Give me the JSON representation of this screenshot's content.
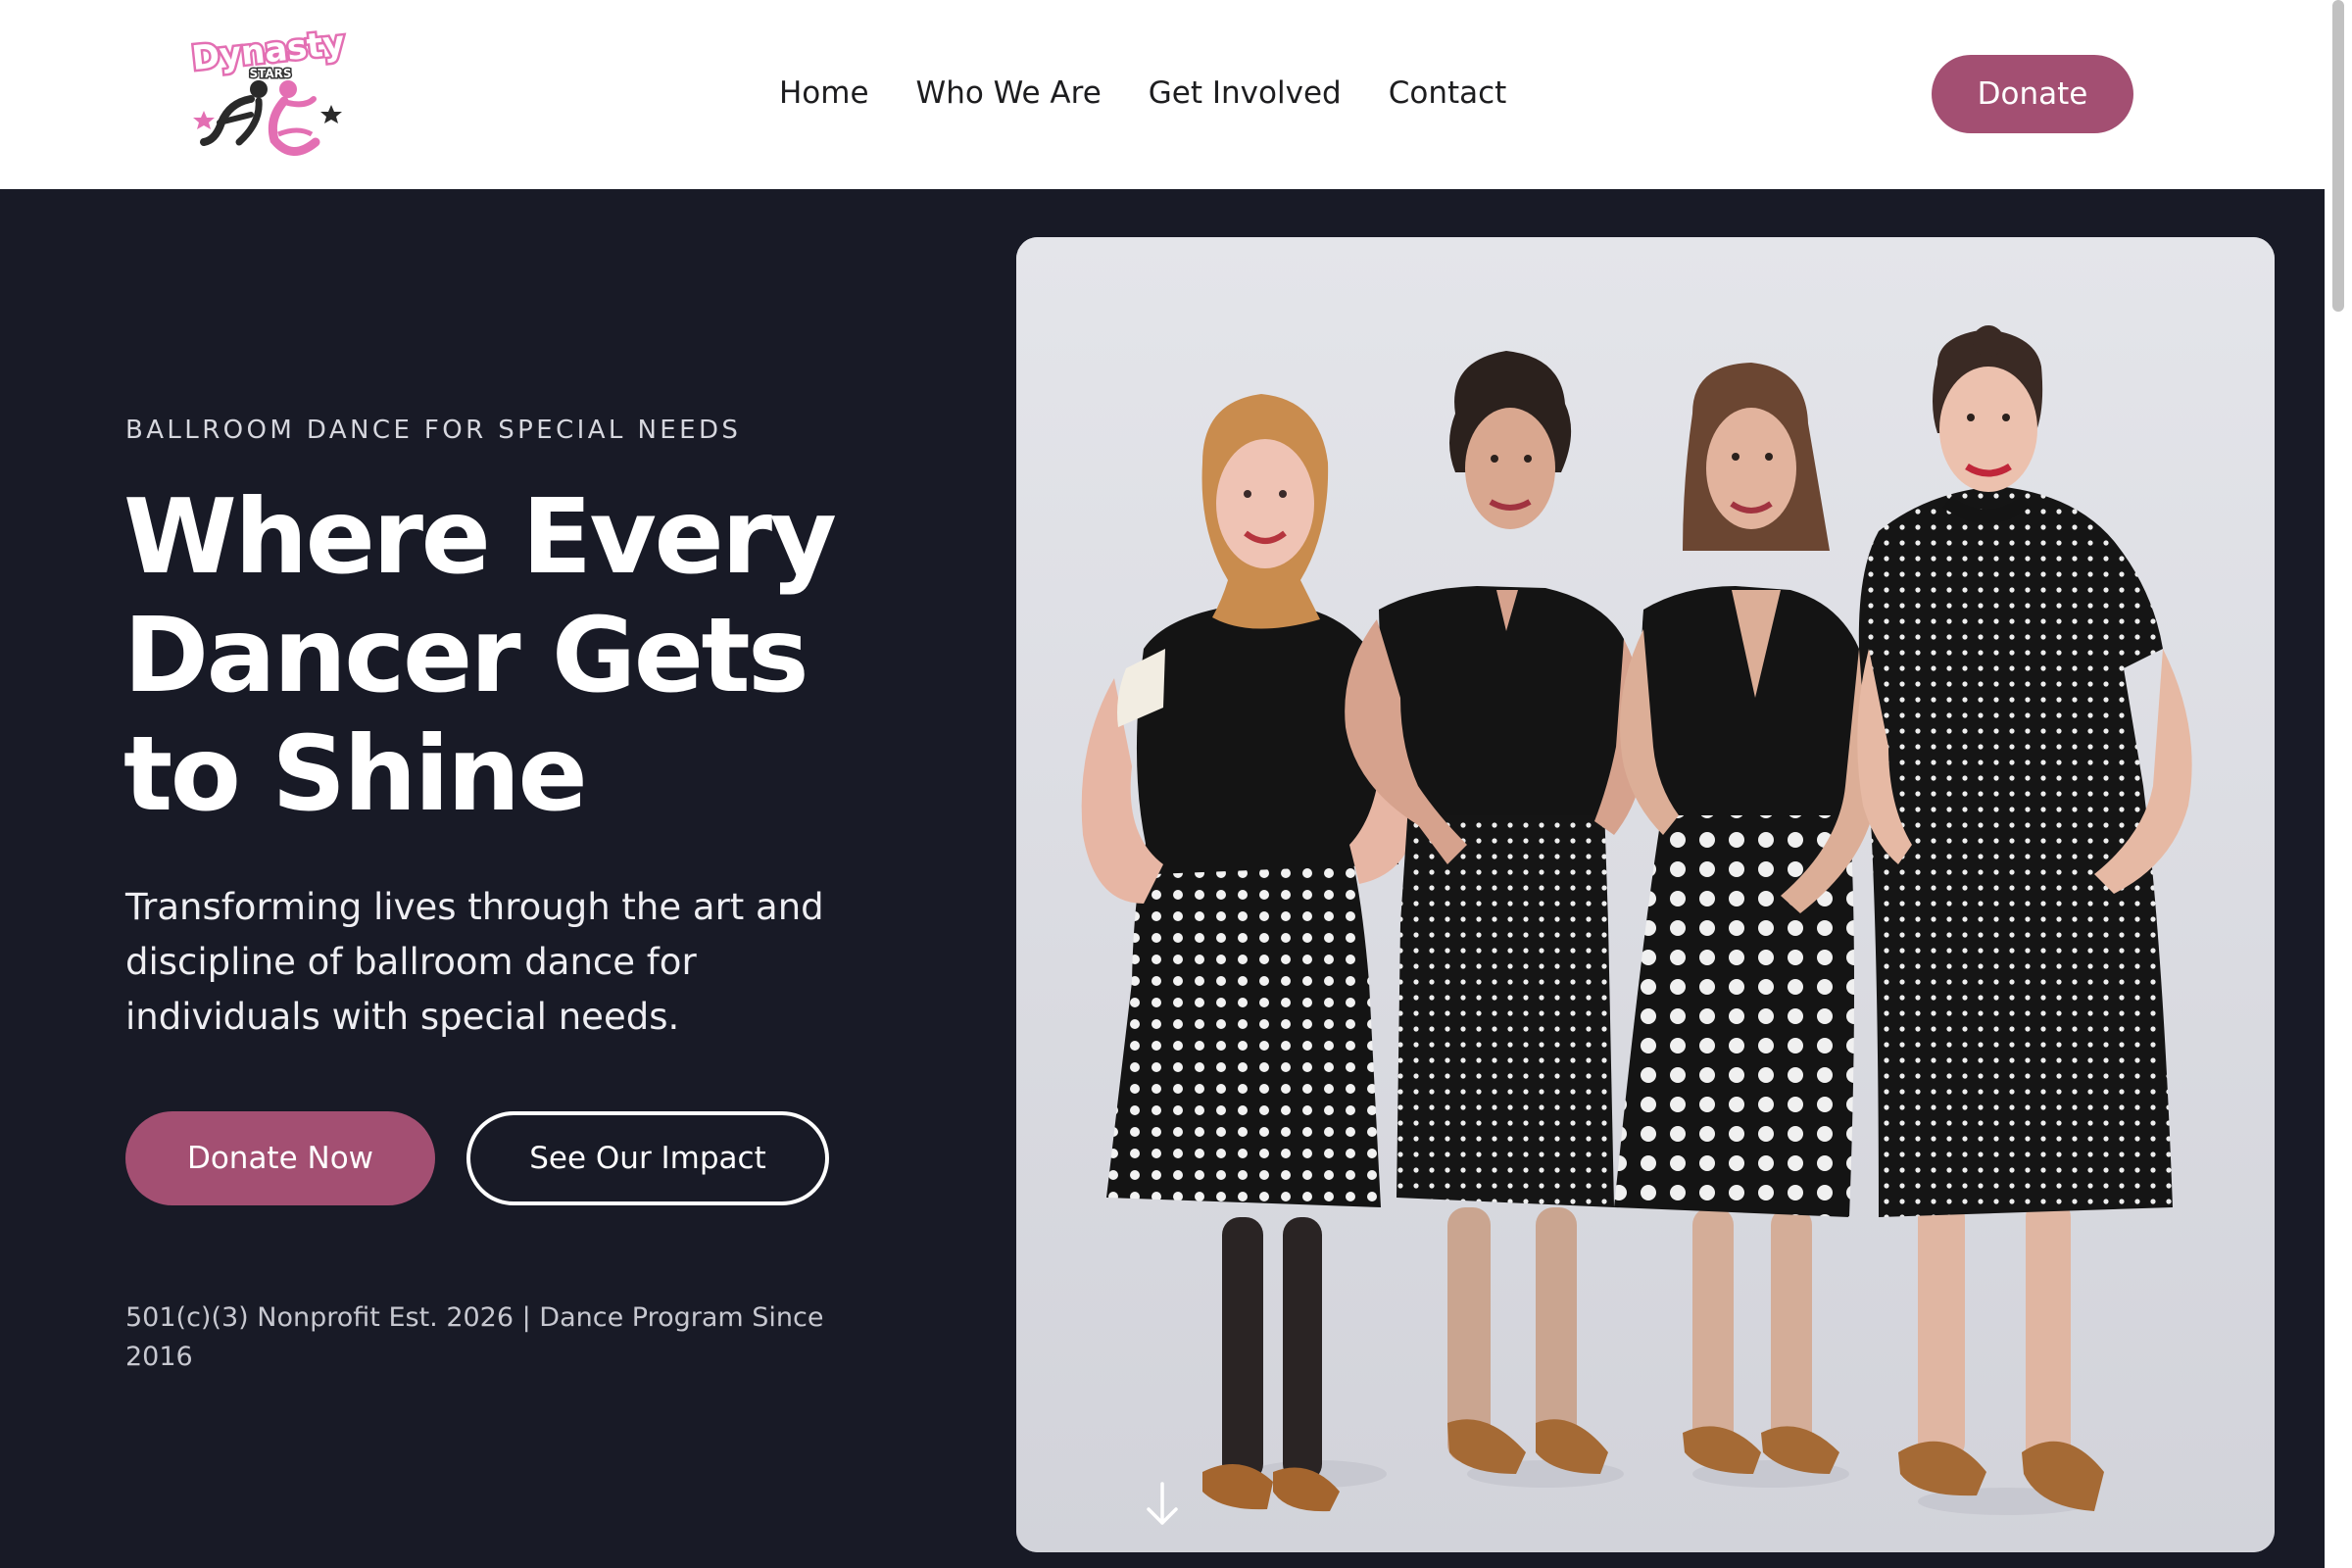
{
  "header": {
    "logo": {
      "text_top": "Dynasty",
      "text_sub": "STARS"
    },
    "nav": [
      "Home",
      "Who We Are",
      "Get Involved",
      "Contact"
    ],
    "donate_label": "Donate"
  },
  "hero": {
    "eyebrow": "BALLROOM DANCE FOR SPECIAL NEEDS",
    "headline_lines": [
      "Where Every",
      "Dancer Gets",
      "to Shine"
    ],
    "subhead": "Transforming lives through the art and discipline of ballroom dance for individuals with special needs.",
    "primary_cta": "Donate Now",
    "secondary_cta": "See Our Impact",
    "established": "501(c)(3) Nonprofit Est. 2026 | Dance Program Since 2016"
  },
  "icons": {
    "scroll_down": "arrow-down-icon"
  },
  "colors": {
    "accent": "#a34f72",
    "hero_bg": "#181a26",
    "logo_pink": "#e36fb3",
    "header_bg": "#ffffff"
  }
}
